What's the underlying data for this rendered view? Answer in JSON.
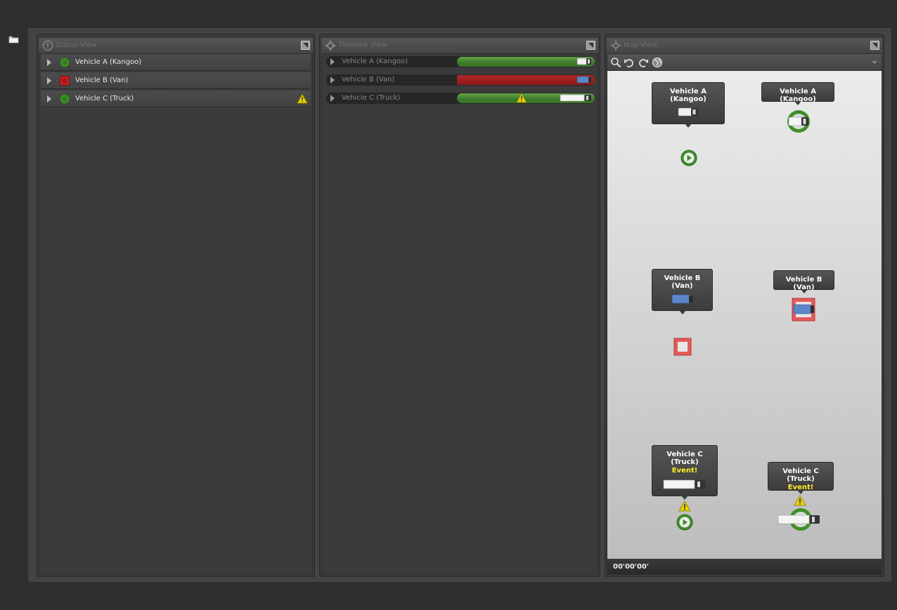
{
  "left_rail": {
    "folder_icon": "folder-icon"
  },
  "panels": {
    "status": {
      "title": "Status View",
      "icon": "alert-circle-icon"
    },
    "timeline": {
      "title": "Timeline View",
      "icon": "gear-icon"
    },
    "map": {
      "title": "Map View",
      "icon": "crosshair-icon"
    }
  },
  "vehicles": [
    {
      "name": "Vehicle A (Kangoo)",
      "status": "ok",
      "status_color": "#3f8f2a",
      "warning": false,
      "kind": "kangoo",
      "timeline_progress": 1.0
    },
    {
      "name": "Vehicle B (Van)",
      "status": "alarm",
      "status_color": "#c02020",
      "warning": false,
      "kind": "van",
      "timeline_progress": 1.0
    },
    {
      "name": "Vehicle C (Truck)",
      "status": "ok",
      "status_color": "#3f8f2a",
      "warning": true,
      "kind": "truck",
      "timeline_progress": 1.0
    }
  ],
  "map": {
    "toolbar": [
      "search-icon",
      "undo-icon",
      "redo-icon",
      "globe-icon"
    ],
    "event_label": "Event!",
    "time": "00'00'00'"
  },
  "colors": {
    "ok": "#3f8f2a",
    "alarm": "#c02020",
    "warning": "#e7d200"
  }
}
